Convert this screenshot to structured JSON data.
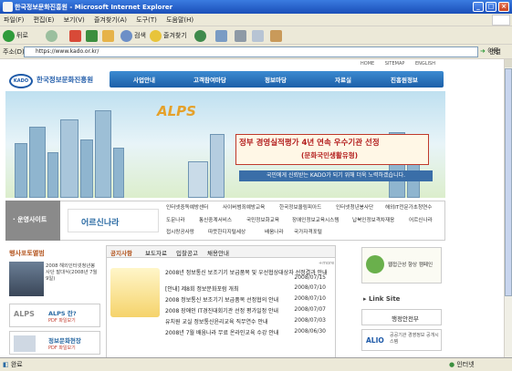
{
  "window": {
    "title": "한국정보문화진흥원 - Microsoft Internet Explorer"
  },
  "menu": [
    "파일(F)",
    "편집(E)",
    "보기(V)",
    "즐겨찾기(A)",
    "도구(T)",
    "도움말(H)"
  ],
  "toolbar": {
    "back": "뒤로",
    "search": "검색",
    "favorites": "즐겨찾기"
  },
  "address": {
    "label": "주소(D)",
    "url": "https://www.kado.or.kr/",
    "go": "이동",
    "links": "연결"
  },
  "site": {
    "toplinks": [
      "HOME",
      "SITEMAP",
      "ENGLISH"
    ],
    "logo_text": "한국정보문화진흥원",
    "logo_abbr": "KADO",
    "nav": [
      "사업안내",
      "고객참여마당",
      "정보마당",
      "자료실",
      "진흥원정보"
    ],
    "hero": {
      "alps": "ALPS",
      "main": "정부 경영실적평가 4년 연속 우수기관 선정",
      "sub": "(문화국민생활유형)",
      "strip": "국민에게 신뢰받는 KADO가 되기 위해 더욱 노력하겠습니다."
    },
    "sites": {
      "label": "운영사이트",
      "logo": "어르신나라",
      "links": [
        "인터넷중독예방센터",
        "사이버범죄예방교육",
        "한국정보올림피아드",
        "인터넷청년봉사단",
        "해외IT전문가초청연수",
        "도문나라",
        "통신중계서비스",
        "국민정보화교육",
        "장애인정보교육시스템",
        "납북인정보격차재응",
        "어르신나라",
        "접시랑공사랑",
        "따뜻한디지털세상",
        "배움나라",
        "국가자격포털"
      ]
    },
    "left": {
      "title": "행사포토앨범",
      "photo_caption": "2008 해외인터넷청년봉사단 발대식(2008년 7월 9일)",
      "alps_title": "ALPS 란?",
      "alps_sub": "PDF 파일보기",
      "info_title": "정보문화현장",
      "info_sub": "PDF 파일보기"
    },
    "mid": {
      "tabs": [
        "공지사항",
        "보도자료",
        "입찰공고",
        "채용안내"
      ],
      "news": [
        {
          "t": "2008년 정보통신 보조기기 보급품목 및 우선협상대상자 선정결과 안내",
          "d": "2008/07/15"
        },
        {
          "t": "[안내] 제8회 정보문화포럼 개최",
          "d": "2008/07/10"
        },
        {
          "t": "2008 정보통신 보조기기 보급품목 선정협의 안내",
          "d": "2008/07/10"
        },
        {
          "t": "2008 장애인 IT경진대회기관 선정 평가일정 안내",
          "d": "2008/07/07"
        },
        {
          "t": "유치원 교실 정보통신윤리교육 직무연수 안내",
          "d": "2008/07/03"
        },
        {
          "t": "2008년 7월 배움나라 무료 온라인교육 수강 안내",
          "d": "2008/06/30"
        }
      ]
    },
    "right": {
      "banner": "웹접근성 향상 캠페인",
      "link_title": "Link Site",
      "ministry": "행정안전부",
      "alio": "ALIO",
      "alio_sub": "공공기관 경영정보 공개시스템"
    }
  },
  "status": {
    "left": "완료",
    "right": "인터넷"
  }
}
